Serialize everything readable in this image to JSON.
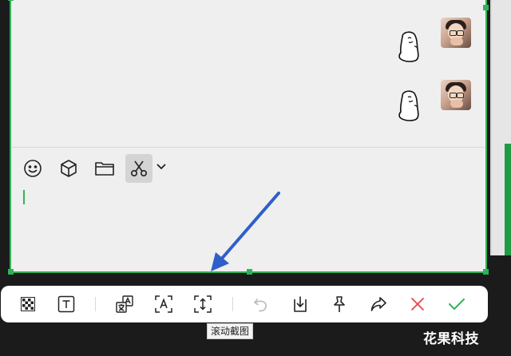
{
  "chat": {
    "messages": [
      {
        "type": "sticker",
        "sender": "self",
        "sticker": "cartoon-ghost-sticker"
      },
      {
        "type": "sticker",
        "sender": "self",
        "sticker": "cartoon-ghost-sticker"
      }
    ]
  },
  "input_toolbar": {
    "items": [
      "emoji-icon",
      "box-icon",
      "folder-icon",
      "scissors-icon",
      "chevron-down-icon"
    ]
  },
  "capture_toolbar": {
    "items": [
      "mosaic-icon",
      "text-icon",
      "translate-icon",
      "text-recognition-icon",
      "scroll-capture-icon",
      "undo-icon",
      "save-icon",
      "pin-icon",
      "share-icon",
      "close-icon",
      "confirm-icon"
    ],
    "tooltip": "滚动截图"
  },
  "colors": {
    "selection": "#2fb35a",
    "annotation_arrow": "#2f5fc9",
    "close": "#e5484d",
    "confirm": "#2fb35a"
  },
  "watermark": "花果科技"
}
